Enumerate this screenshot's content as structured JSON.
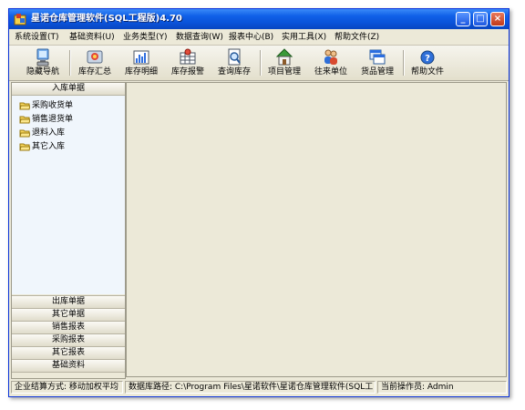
{
  "window": {
    "title": "星诺仓库管理软件(SQL工程版)4.70"
  },
  "menu": [
    {
      "label": "系统设置(T)"
    },
    {
      "label": "基础资料(U)"
    },
    {
      "label": "业务类型(Y)"
    },
    {
      "label": "数据查询(W)"
    },
    {
      "label": "报表中心(B)"
    },
    {
      "label": "实用工具(X)"
    },
    {
      "label": "帮助文件(Z)"
    }
  ],
  "toolbar": [
    {
      "label": "隐藏导航",
      "icon": "monitor-icon"
    },
    {
      "label": "库存汇总",
      "icon": "stock-summary-icon"
    },
    {
      "label": "库存明细",
      "icon": "bar-chart-icon"
    },
    {
      "label": "库存报警",
      "icon": "alarm-grid-icon"
    },
    {
      "label": "查询库存",
      "icon": "search-doc-icon"
    },
    {
      "label": "项目管理",
      "icon": "house-icon"
    },
    {
      "label": "往来单位",
      "icon": "people-icon"
    },
    {
      "label": "货品管理",
      "icon": "windows-icon"
    },
    {
      "label": "帮助文件",
      "icon": "help-icon"
    }
  ],
  "nav": {
    "active_section": "入库单据",
    "items": [
      "采购收货单",
      "销售退货单",
      "退料入库",
      "其它入库"
    ],
    "sections": [
      "出库单据",
      "其它单据",
      "销售报表",
      "采购报表",
      "其它报表",
      "基础资料"
    ]
  },
  "status": {
    "costing": "企业结算方式: 移动加权平均",
    "db_path": "数据库路径: C:\\Program Files\\星诺软件\\星诺仓库管理软件(SQL工",
    "operator": "当前操作员: Admin"
  },
  "colors": {
    "titlebar": "#0a52d8",
    "tree_bg": "#f0f6fc",
    "face": "#ece9d8"
  }
}
